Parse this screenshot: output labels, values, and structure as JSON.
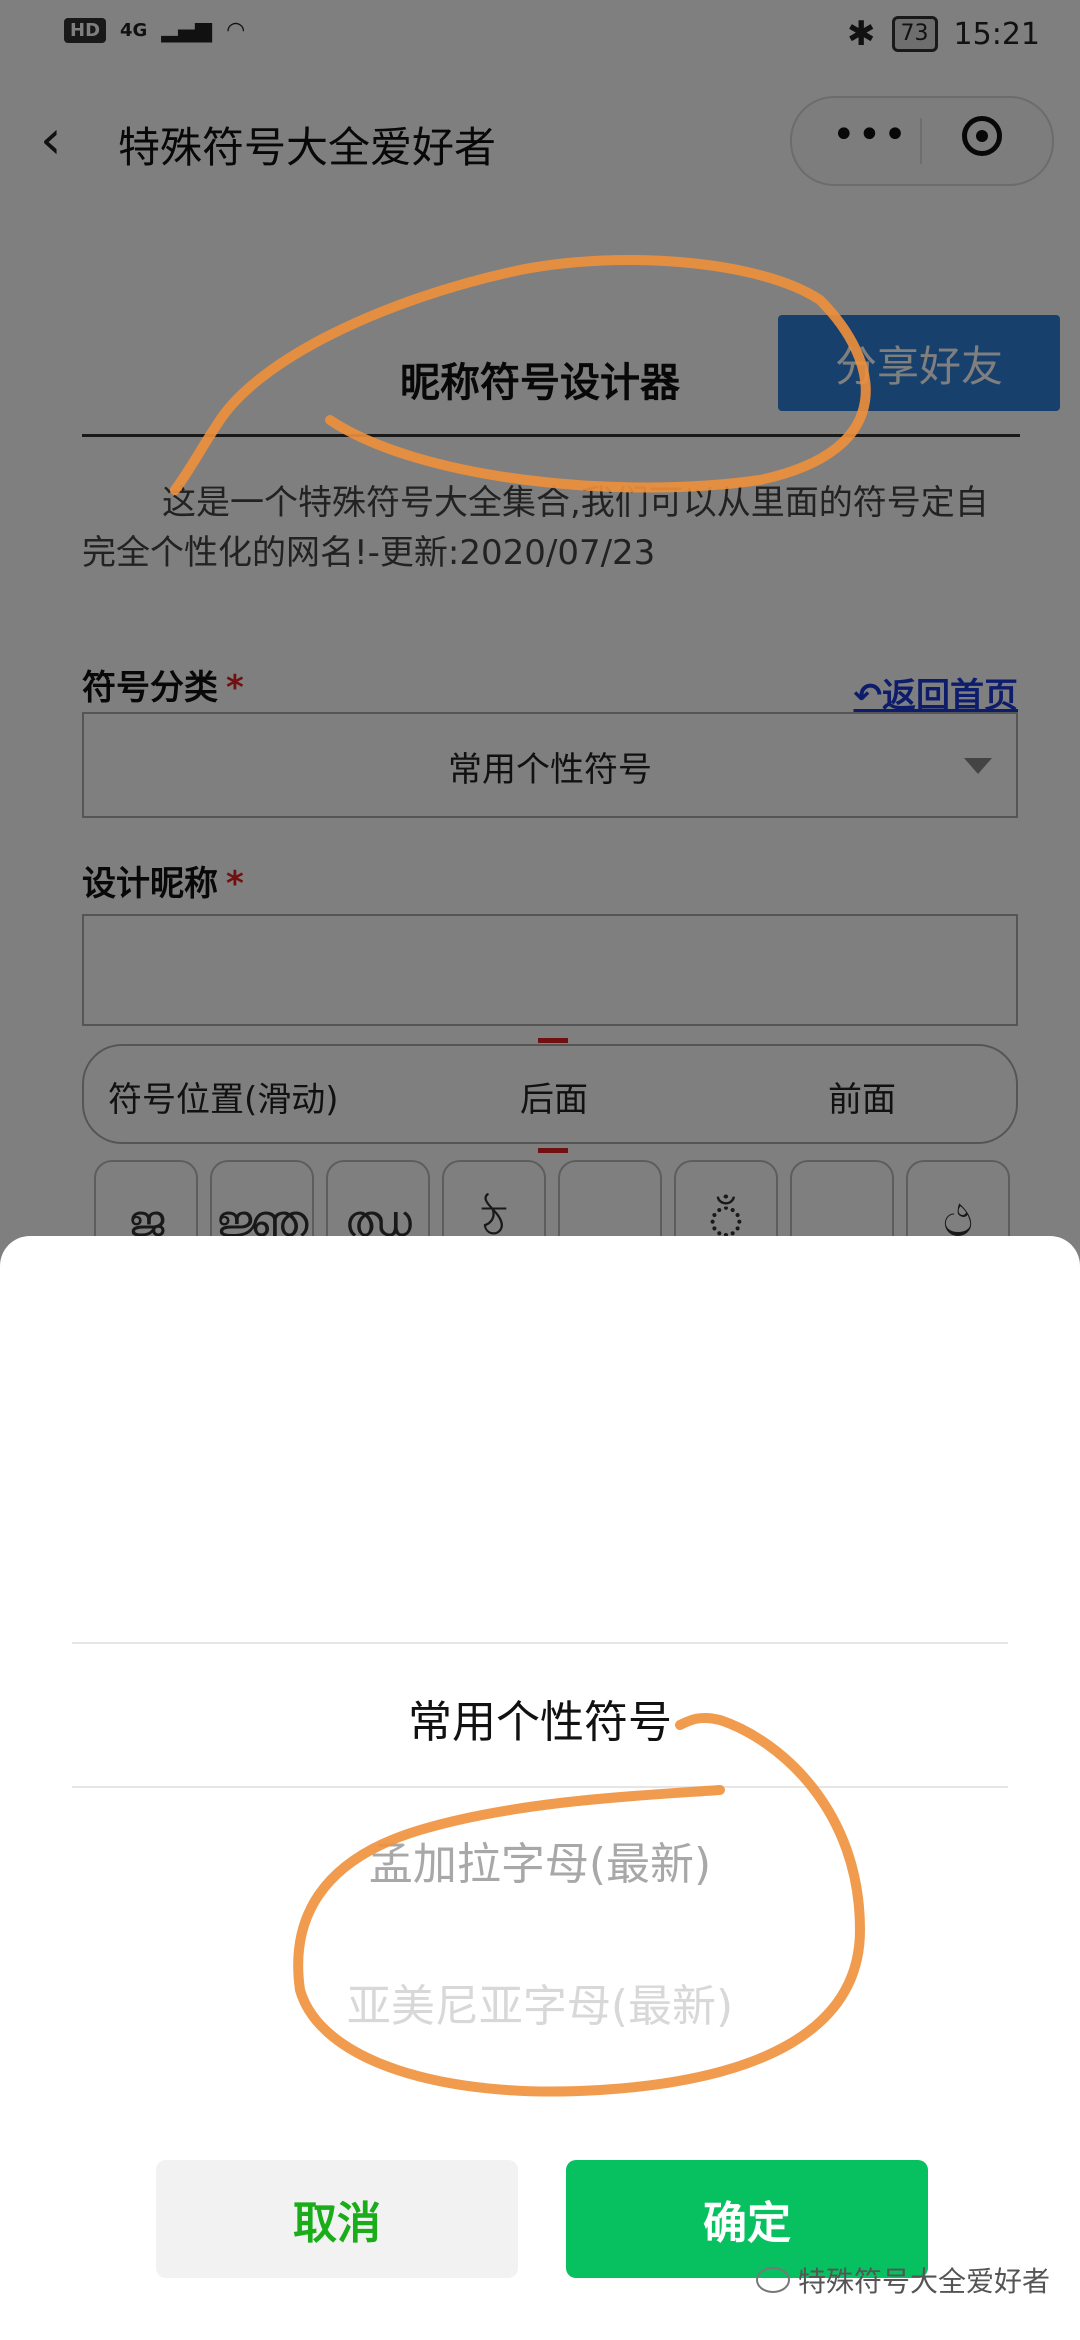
{
  "status_bar": {
    "hd": "HD",
    "signal": "4G",
    "battery": "73",
    "time": "15:21"
  },
  "nav": {
    "back_icon": "chevron-left-icon",
    "title": "特殊符号大全爱好者",
    "more_icon": "more-dots-icon",
    "close_icon": "target-circle-icon"
  },
  "card": {
    "title": "昵称符号设计器",
    "share_button": "分享好友",
    "description": "这是一个特殊符号大全集合,我们可以从里面的符号定自完全个性化的网名!-更新:2020/07/23",
    "category_label": "符号分类",
    "required_mark": "*",
    "home_link": "↶返回首页",
    "category_value": "常用个性符号",
    "nickname_label": "设计昵称",
    "position_label": "符号位置(滑动)",
    "position_back": "后面",
    "position_front": "前面",
    "symbols": [
      "ജ",
      "ജ്ഞ",
      "ഝ",
      "ঠ",
      "",
      "ঁ",
      "",
      "ථ"
    ]
  },
  "picker": {
    "options": [
      "常用个性符号",
      "孟加拉字母(最新)",
      "亚美尼亚字母(最新)"
    ],
    "cancel": "取消",
    "confirm": "确定"
  },
  "watermark": "特殊符号大全爱好者",
  "colors": {
    "share_button": "#2f80d8",
    "confirm_button": "#07c160",
    "cancel_text": "#1aad19",
    "annotation": "#f0903c"
  }
}
